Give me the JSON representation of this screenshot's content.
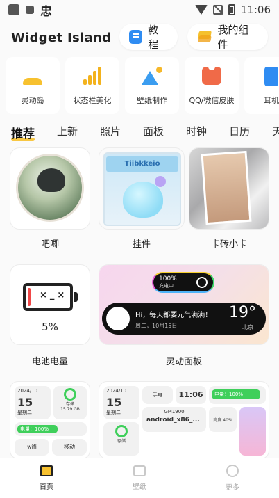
{
  "status_bar": {
    "time": "11:06",
    "left_glyph": "忠"
  },
  "header": {
    "app_title": "Widget Island",
    "tutorial_label": "教程",
    "my_widgets_label": "我的组件"
  },
  "features": [
    {
      "label": "灵动岛",
      "icon": "island-icon"
    },
    {
      "label": "状态栏美化",
      "icon": "bar-chart-icon"
    },
    {
      "label": "壁纸制作",
      "icon": "mountain-icon"
    },
    {
      "label": "QQ/微信皮肤",
      "icon": "shirt-icon"
    },
    {
      "label": "耳机",
      "icon": "phone-icon"
    }
  ],
  "tabs": [
    "推荐",
    "上新",
    "照片",
    "面板",
    "时钟",
    "日历",
    "天"
  ],
  "grid": {
    "item1": {
      "caption": "吧唧"
    },
    "item2": {
      "caption": "挂件",
      "band_text": "Tiibkkeio"
    },
    "item3": {
      "caption": "卡砖小卡"
    },
    "item4": {
      "caption": "电池电量",
      "percent": "5%",
      "face": "×_×"
    },
    "item5": {
      "caption": "灵动面板",
      "pill_percent": "100%",
      "pill_sub": "充电中",
      "greeting": "Hi，每天都要元气满满！",
      "date": "周二，10月15日",
      "temp": "19°",
      "city": "北京"
    }
  },
  "widgets_row": {
    "left": {
      "date_top": "2024/10",
      "day": "15",
      "weekday": "星期二",
      "storage_label": "存储",
      "storage_value": "15.79 GB",
      "battery_label": "电量：100%",
      "wifi": "wifi",
      "signal": "移动"
    },
    "right": {
      "date_top": "2024/10",
      "day": "15",
      "weekday": "星期二",
      "time": "11:06",
      "battery": "电量：100%",
      "device": "android_x86_...",
      "model": "GM1900",
      "flash": "手电",
      "bright": "亮度 40%",
      "storage": "存储"
    }
  },
  "bottom_nav": [
    {
      "label": "首页",
      "icon": "home-icon",
      "active": true
    },
    {
      "label": "壁纸",
      "icon": "image-icon",
      "active": false
    },
    {
      "label": "更多",
      "icon": "face-icon",
      "active": false
    }
  ]
}
